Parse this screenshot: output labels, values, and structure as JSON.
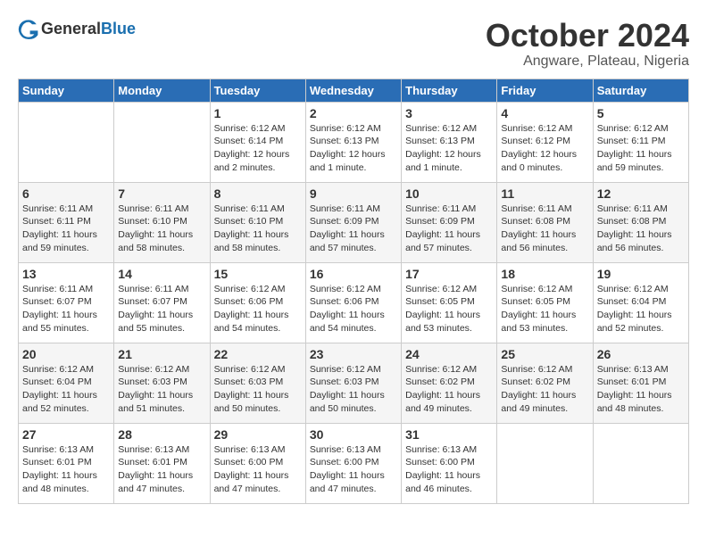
{
  "header": {
    "logo_general": "General",
    "logo_blue": "Blue",
    "month_title": "October 2024",
    "subtitle": "Angware, Plateau, Nigeria"
  },
  "weekdays": [
    "Sunday",
    "Monday",
    "Tuesday",
    "Wednesday",
    "Thursday",
    "Friday",
    "Saturday"
  ],
  "weeks": [
    [
      {
        "day": "",
        "detail": ""
      },
      {
        "day": "",
        "detail": ""
      },
      {
        "day": "1",
        "detail": "Sunrise: 6:12 AM\nSunset: 6:14 PM\nDaylight: 12 hours\nand 2 minutes."
      },
      {
        "day": "2",
        "detail": "Sunrise: 6:12 AM\nSunset: 6:13 PM\nDaylight: 12 hours\nand 1 minute."
      },
      {
        "day": "3",
        "detail": "Sunrise: 6:12 AM\nSunset: 6:13 PM\nDaylight: 12 hours\nand 1 minute."
      },
      {
        "day": "4",
        "detail": "Sunrise: 6:12 AM\nSunset: 6:12 PM\nDaylight: 12 hours\nand 0 minutes."
      },
      {
        "day": "5",
        "detail": "Sunrise: 6:12 AM\nSunset: 6:11 PM\nDaylight: 11 hours\nand 59 minutes."
      }
    ],
    [
      {
        "day": "6",
        "detail": "Sunrise: 6:11 AM\nSunset: 6:11 PM\nDaylight: 11 hours\nand 59 minutes."
      },
      {
        "day": "7",
        "detail": "Sunrise: 6:11 AM\nSunset: 6:10 PM\nDaylight: 11 hours\nand 58 minutes."
      },
      {
        "day": "8",
        "detail": "Sunrise: 6:11 AM\nSunset: 6:10 PM\nDaylight: 11 hours\nand 58 minutes."
      },
      {
        "day": "9",
        "detail": "Sunrise: 6:11 AM\nSunset: 6:09 PM\nDaylight: 11 hours\nand 57 minutes."
      },
      {
        "day": "10",
        "detail": "Sunrise: 6:11 AM\nSunset: 6:09 PM\nDaylight: 11 hours\nand 57 minutes."
      },
      {
        "day": "11",
        "detail": "Sunrise: 6:11 AM\nSunset: 6:08 PM\nDaylight: 11 hours\nand 56 minutes."
      },
      {
        "day": "12",
        "detail": "Sunrise: 6:11 AM\nSunset: 6:08 PM\nDaylight: 11 hours\nand 56 minutes."
      }
    ],
    [
      {
        "day": "13",
        "detail": "Sunrise: 6:11 AM\nSunset: 6:07 PM\nDaylight: 11 hours\nand 55 minutes."
      },
      {
        "day": "14",
        "detail": "Sunrise: 6:11 AM\nSunset: 6:07 PM\nDaylight: 11 hours\nand 55 minutes."
      },
      {
        "day": "15",
        "detail": "Sunrise: 6:12 AM\nSunset: 6:06 PM\nDaylight: 11 hours\nand 54 minutes."
      },
      {
        "day": "16",
        "detail": "Sunrise: 6:12 AM\nSunset: 6:06 PM\nDaylight: 11 hours\nand 54 minutes."
      },
      {
        "day": "17",
        "detail": "Sunrise: 6:12 AM\nSunset: 6:05 PM\nDaylight: 11 hours\nand 53 minutes."
      },
      {
        "day": "18",
        "detail": "Sunrise: 6:12 AM\nSunset: 6:05 PM\nDaylight: 11 hours\nand 53 minutes."
      },
      {
        "day": "19",
        "detail": "Sunrise: 6:12 AM\nSunset: 6:04 PM\nDaylight: 11 hours\nand 52 minutes."
      }
    ],
    [
      {
        "day": "20",
        "detail": "Sunrise: 6:12 AM\nSunset: 6:04 PM\nDaylight: 11 hours\nand 52 minutes."
      },
      {
        "day": "21",
        "detail": "Sunrise: 6:12 AM\nSunset: 6:03 PM\nDaylight: 11 hours\nand 51 minutes."
      },
      {
        "day": "22",
        "detail": "Sunrise: 6:12 AM\nSunset: 6:03 PM\nDaylight: 11 hours\nand 50 minutes."
      },
      {
        "day": "23",
        "detail": "Sunrise: 6:12 AM\nSunset: 6:03 PM\nDaylight: 11 hours\nand 50 minutes."
      },
      {
        "day": "24",
        "detail": "Sunrise: 6:12 AM\nSunset: 6:02 PM\nDaylight: 11 hours\nand 49 minutes."
      },
      {
        "day": "25",
        "detail": "Sunrise: 6:12 AM\nSunset: 6:02 PM\nDaylight: 11 hours\nand 49 minutes."
      },
      {
        "day": "26",
        "detail": "Sunrise: 6:13 AM\nSunset: 6:01 PM\nDaylight: 11 hours\nand 48 minutes."
      }
    ],
    [
      {
        "day": "27",
        "detail": "Sunrise: 6:13 AM\nSunset: 6:01 PM\nDaylight: 11 hours\nand 48 minutes."
      },
      {
        "day": "28",
        "detail": "Sunrise: 6:13 AM\nSunset: 6:01 PM\nDaylight: 11 hours\nand 47 minutes."
      },
      {
        "day": "29",
        "detail": "Sunrise: 6:13 AM\nSunset: 6:00 PM\nDaylight: 11 hours\nand 47 minutes."
      },
      {
        "day": "30",
        "detail": "Sunrise: 6:13 AM\nSunset: 6:00 PM\nDaylight: 11 hours\nand 47 minutes."
      },
      {
        "day": "31",
        "detail": "Sunrise: 6:13 AM\nSunset: 6:00 PM\nDaylight: 11 hours\nand 46 minutes."
      },
      {
        "day": "",
        "detail": ""
      },
      {
        "day": "",
        "detail": ""
      }
    ]
  ]
}
